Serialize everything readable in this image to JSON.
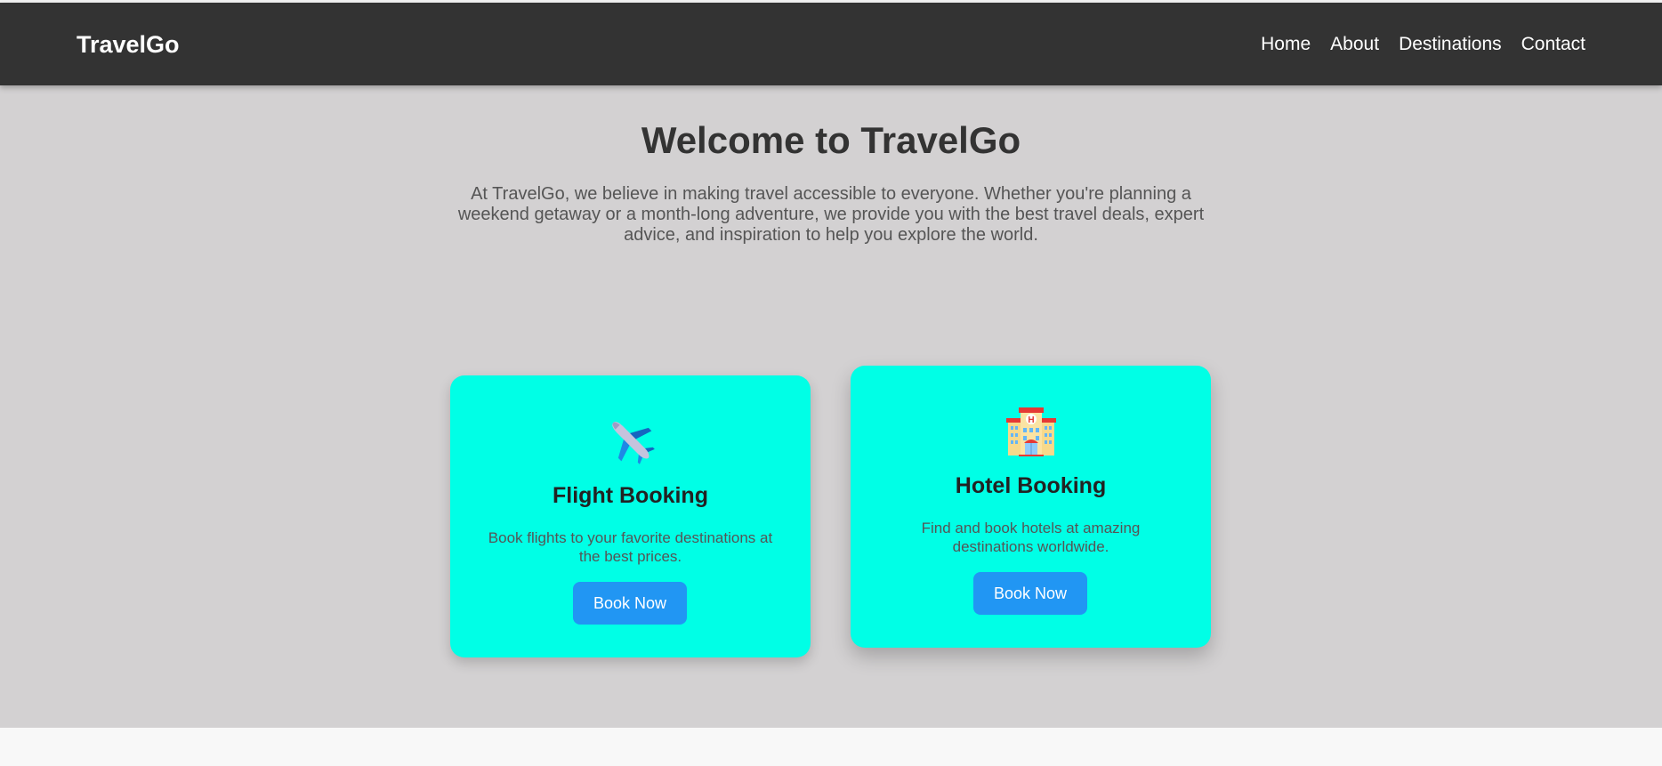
{
  "navbar": {
    "brand": "TravelGo",
    "links": [
      "Home",
      "About",
      "Destinations",
      "Contact"
    ]
  },
  "hero": {
    "title": "Welcome to TravelGo",
    "text": "At TravelGo, we believe in making travel accessible to everyone. Whether you're planning a weekend getaway or a month-long adventure, we provide you with the best travel deals, expert advice, and inspiration to help you explore the world."
  },
  "cards": [
    {
      "icon": "airplane-icon",
      "title": "Flight Booking",
      "text": "Book flights to your favorite destinations at the best prices.",
      "button": "Book Now"
    },
    {
      "icon": "hotel-icon",
      "title": "Hotel Booking",
      "text": "Find and book hotels at amazing destinations worldwide.",
      "button": "Book Now"
    }
  ],
  "colors": {
    "navbar_bg": "#333333",
    "hero_bg": "#d3d1d2",
    "card_bg": "#00ffe6",
    "button_bg": "#2196f3"
  }
}
